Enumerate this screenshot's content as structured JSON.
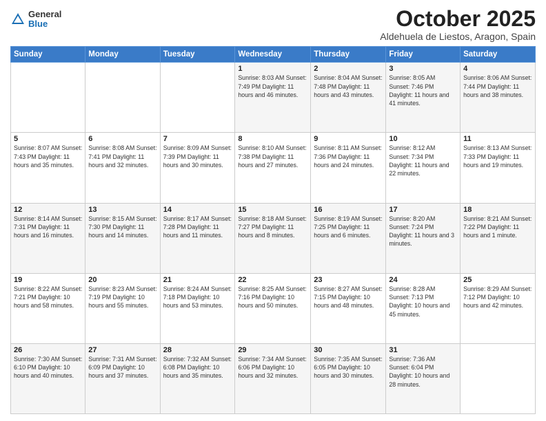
{
  "header": {
    "logo_general": "General",
    "logo_blue": "Blue",
    "title": "October 2025",
    "subtitle": "Aldehuela de Liestos, Aragon, Spain"
  },
  "weekdays": [
    "Sunday",
    "Monday",
    "Tuesday",
    "Wednesday",
    "Thursday",
    "Friday",
    "Saturday"
  ],
  "weeks": [
    [
      {
        "day": "",
        "info": ""
      },
      {
        "day": "",
        "info": ""
      },
      {
        "day": "",
        "info": ""
      },
      {
        "day": "1",
        "info": "Sunrise: 8:03 AM\nSunset: 7:49 PM\nDaylight: 11 hours and 46 minutes."
      },
      {
        "day": "2",
        "info": "Sunrise: 8:04 AM\nSunset: 7:48 PM\nDaylight: 11 hours and 43 minutes."
      },
      {
        "day": "3",
        "info": "Sunrise: 8:05 AM\nSunset: 7:46 PM\nDaylight: 11 hours and 41 minutes."
      },
      {
        "day": "4",
        "info": "Sunrise: 8:06 AM\nSunset: 7:44 PM\nDaylight: 11 hours and 38 minutes."
      }
    ],
    [
      {
        "day": "5",
        "info": "Sunrise: 8:07 AM\nSunset: 7:43 PM\nDaylight: 11 hours and 35 minutes."
      },
      {
        "day": "6",
        "info": "Sunrise: 8:08 AM\nSunset: 7:41 PM\nDaylight: 11 hours and 32 minutes."
      },
      {
        "day": "7",
        "info": "Sunrise: 8:09 AM\nSunset: 7:39 PM\nDaylight: 11 hours and 30 minutes."
      },
      {
        "day": "8",
        "info": "Sunrise: 8:10 AM\nSunset: 7:38 PM\nDaylight: 11 hours and 27 minutes."
      },
      {
        "day": "9",
        "info": "Sunrise: 8:11 AM\nSunset: 7:36 PM\nDaylight: 11 hours and 24 minutes."
      },
      {
        "day": "10",
        "info": "Sunrise: 8:12 AM\nSunset: 7:34 PM\nDaylight: 11 hours and 22 minutes."
      },
      {
        "day": "11",
        "info": "Sunrise: 8:13 AM\nSunset: 7:33 PM\nDaylight: 11 hours and 19 minutes."
      }
    ],
    [
      {
        "day": "12",
        "info": "Sunrise: 8:14 AM\nSunset: 7:31 PM\nDaylight: 11 hours and 16 minutes."
      },
      {
        "day": "13",
        "info": "Sunrise: 8:15 AM\nSunset: 7:30 PM\nDaylight: 11 hours and 14 minutes."
      },
      {
        "day": "14",
        "info": "Sunrise: 8:17 AM\nSunset: 7:28 PM\nDaylight: 11 hours and 11 minutes."
      },
      {
        "day": "15",
        "info": "Sunrise: 8:18 AM\nSunset: 7:27 PM\nDaylight: 11 hours and 8 minutes."
      },
      {
        "day": "16",
        "info": "Sunrise: 8:19 AM\nSunset: 7:25 PM\nDaylight: 11 hours and 6 minutes."
      },
      {
        "day": "17",
        "info": "Sunrise: 8:20 AM\nSunset: 7:24 PM\nDaylight: 11 hours and 3 minutes."
      },
      {
        "day": "18",
        "info": "Sunrise: 8:21 AM\nSunset: 7:22 PM\nDaylight: 11 hours and 1 minute."
      }
    ],
    [
      {
        "day": "19",
        "info": "Sunrise: 8:22 AM\nSunset: 7:21 PM\nDaylight: 10 hours and 58 minutes."
      },
      {
        "day": "20",
        "info": "Sunrise: 8:23 AM\nSunset: 7:19 PM\nDaylight: 10 hours and 55 minutes."
      },
      {
        "day": "21",
        "info": "Sunrise: 8:24 AM\nSunset: 7:18 PM\nDaylight: 10 hours and 53 minutes."
      },
      {
        "day": "22",
        "info": "Sunrise: 8:25 AM\nSunset: 7:16 PM\nDaylight: 10 hours and 50 minutes."
      },
      {
        "day": "23",
        "info": "Sunrise: 8:27 AM\nSunset: 7:15 PM\nDaylight: 10 hours and 48 minutes."
      },
      {
        "day": "24",
        "info": "Sunrise: 8:28 AM\nSunset: 7:13 PM\nDaylight: 10 hours and 45 minutes."
      },
      {
        "day": "25",
        "info": "Sunrise: 8:29 AM\nSunset: 7:12 PM\nDaylight: 10 hours and 42 minutes."
      }
    ],
    [
      {
        "day": "26",
        "info": "Sunrise: 7:30 AM\nSunset: 6:10 PM\nDaylight: 10 hours and 40 minutes."
      },
      {
        "day": "27",
        "info": "Sunrise: 7:31 AM\nSunset: 6:09 PM\nDaylight: 10 hours and 37 minutes."
      },
      {
        "day": "28",
        "info": "Sunrise: 7:32 AM\nSunset: 6:08 PM\nDaylight: 10 hours and 35 minutes."
      },
      {
        "day": "29",
        "info": "Sunrise: 7:34 AM\nSunset: 6:06 PM\nDaylight: 10 hours and 32 minutes."
      },
      {
        "day": "30",
        "info": "Sunrise: 7:35 AM\nSunset: 6:05 PM\nDaylight: 10 hours and 30 minutes."
      },
      {
        "day": "31",
        "info": "Sunrise: 7:36 AM\nSunset: 6:04 PM\nDaylight: 10 hours and 28 minutes."
      },
      {
        "day": "",
        "info": ""
      }
    ]
  ]
}
